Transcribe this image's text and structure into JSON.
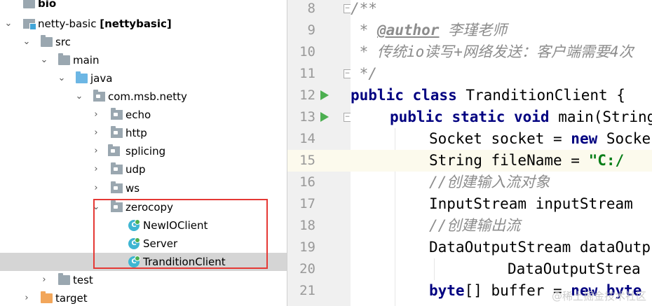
{
  "tree": {
    "bio": {
      "name": "bio"
    },
    "module": {
      "name": "netty-basic",
      "qualifier": "[nettybasic]"
    },
    "src": "src",
    "main": "main",
    "java": "java",
    "package": "com.msb.netty",
    "echo": "echo",
    "http": "http",
    "splicing": "splicing",
    "udp": "udp",
    "ws": "ws",
    "zerocopy": "zerocopy",
    "newio_client": "NewIOClient",
    "server": "Server",
    "tradition_client": "TranditionClient",
    "test": "test",
    "target": "target",
    "class_icon_letter": "C"
  },
  "editor": {
    "lines": {
      "n8": "8",
      "n9": "9",
      "n10": "10",
      "n11": "11",
      "n12": "12",
      "n13": "13",
      "n14": "14",
      "n15": "15",
      "n16": "16",
      "n17": "17",
      "n18": "18",
      "n19": "19",
      "n20": "20",
      "n21": "21"
    },
    "code": {
      "l8": "/**",
      "l9_prefix": " * ",
      "l9_tag": "@author",
      "l9_text": " 李瑾老师",
      "l10": " * 传统io读写+网络发送：客户端需要4次",
      "l11": " */",
      "l12_kw": "public class",
      "l12_rest": " TranditionClient {",
      "l13_kw": "public static void",
      "l13_rest": " main(String",
      "l14_a": "Socket socket = ",
      "l14_kw": "new",
      "l14_b": " Socke",
      "l15_a": "String fileName = ",
      "l15_str": "\"C:/",
      "l16": "//创建输入流对象",
      "l17": "InputStream inputStream",
      "l18": "//创建输出流",
      "l19": "DataOutputStream dataOutp",
      "l20": "DataOutputStrea",
      "l21_kw": "byte",
      "l21_a": "[] buffer = ",
      "l21_kw2": "new",
      "l21_b": " byte"
    }
  },
  "watermark": "@稀土掘金技术社区",
  "colors": {
    "selection": "#d5d5d5",
    "highlight_box": "#e53935",
    "keyword": "#000080",
    "comment": "#8c8c8c",
    "string": "#067d17",
    "run_icon": "#4caf50"
  }
}
